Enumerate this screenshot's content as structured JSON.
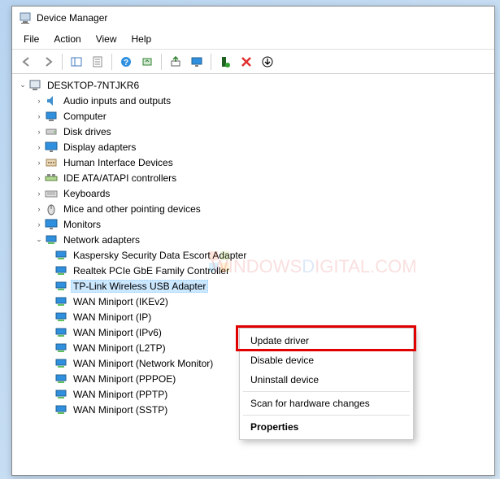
{
  "window": {
    "title": "Device Manager"
  },
  "menubar": [
    "File",
    "Action",
    "View",
    "Help"
  ],
  "tree": {
    "root": "DESKTOP-7NTJKR6",
    "categories": [
      {
        "label": "Audio inputs and outputs",
        "expanded": false
      },
      {
        "label": "Computer",
        "expanded": false
      },
      {
        "label": "Disk drives",
        "expanded": false
      },
      {
        "label": "Display adapters",
        "expanded": false
      },
      {
        "label": "Human Interface Devices",
        "expanded": false
      },
      {
        "label": "IDE ATA/ATAPI controllers",
        "expanded": false
      },
      {
        "label": "Keyboards",
        "expanded": false
      },
      {
        "label": "Mice and other pointing devices",
        "expanded": false
      },
      {
        "label": "Monitors",
        "expanded": false
      },
      {
        "label": "Network adapters",
        "expanded": true
      }
    ],
    "network_children": [
      {
        "label": "Kaspersky Security Data Escort Adapter",
        "selected": false
      },
      {
        "label": "Realtek PCIe GbE Family Controller",
        "selected": false
      },
      {
        "label": "TP-Link Wireless USB Adapter",
        "selected": true
      },
      {
        "label": "WAN Miniport (IKEv2)",
        "selected": false
      },
      {
        "label": "WAN Miniport (IP)",
        "selected": false
      },
      {
        "label": "WAN Miniport (IPv6)",
        "selected": false
      },
      {
        "label": "WAN Miniport (L2TP)",
        "selected": false
      },
      {
        "label": "WAN Miniport (Network Monitor)",
        "selected": false
      },
      {
        "label": "WAN Miniport (PPPOE)",
        "selected": false
      },
      {
        "label": "WAN Miniport (PPTP)",
        "selected": false
      },
      {
        "label": "WAN Miniport (SSTP)",
        "selected": false
      }
    ]
  },
  "context_menu": {
    "items": [
      {
        "label": "Update driver",
        "highlighted": true
      },
      {
        "label": "Disable device"
      },
      {
        "label": "Uninstall device"
      }
    ],
    "items2": [
      {
        "label": "Scan for hardware changes"
      }
    ],
    "items3": [
      {
        "label": "Properties",
        "bold": true
      }
    ]
  },
  "watermark": {
    "part1": "W",
    "part2": "INDOWS",
    "part3": "D",
    "part4": "IGITAL.COM"
  }
}
